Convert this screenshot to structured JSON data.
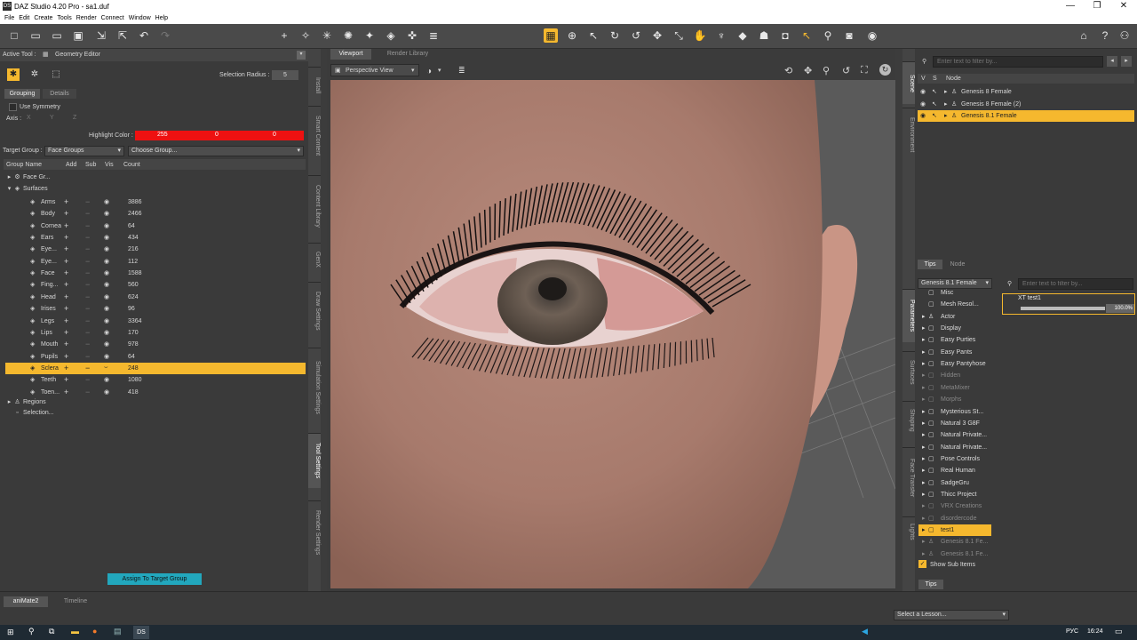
{
  "window": {
    "title": "DAZ Studio 4.20 Pro - sa1.duf",
    "min": "—",
    "max": "❐",
    "close": "✕"
  },
  "menu": [
    "File",
    "Edit",
    "Create",
    "Tools",
    "Render",
    "Connect",
    "Window",
    "Help"
  ],
  "left": {
    "active_tool_label": "Active Tool :",
    "active_tool": "Geometry Editor",
    "selection_radius_label": "Selection Radius :",
    "selection_radius": "5",
    "tabs": [
      "Grouping",
      "Details"
    ],
    "use_symmetry": "Use Symmetry",
    "axis": "Axis :",
    "axis_options": [
      "X",
      "Y",
      "Z"
    ],
    "highlight_label": "Highlight Color :",
    "highlight": [
      "255",
      "0",
      "0"
    ],
    "target_group_label": "Target Group :",
    "target_group": "Face Groups",
    "choose_group": "Choose Group...",
    "headers": [
      "Group Name",
      "Add",
      "Sub",
      "Vis",
      "Count"
    ],
    "face_groups": "Face Gr...",
    "surfaces": "Surfaces",
    "items": [
      {
        "name": "Arms",
        "count": "3886"
      },
      {
        "name": "Body",
        "count": "2466"
      },
      {
        "name": "Cornea",
        "count": "64"
      },
      {
        "name": "Ears",
        "count": "434"
      },
      {
        "name": "Eye...",
        "count": "216"
      },
      {
        "name": "Eye...",
        "count": "112"
      },
      {
        "name": "Face",
        "count": "1588"
      },
      {
        "name": "Fing...",
        "count": "560"
      },
      {
        "name": "Head",
        "count": "624"
      },
      {
        "name": "Irises",
        "count": "96"
      },
      {
        "name": "Legs",
        "count": "3364"
      },
      {
        "name": "Lips",
        "count": "170"
      },
      {
        "name": "Mouth",
        "count": "978"
      },
      {
        "name": "Pupils",
        "count": "64"
      },
      {
        "name": "Sclera",
        "count": "248"
      },
      {
        "name": "Teeth",
        "count": "1080"
      },
      {
        "name": "Toen...",
        "count": "418"
      }
    ],
    "regions": "Regions",
    "selection": "Selection...",
    "assign_button": "Assign To Target Group"
  },
  "side_tabs": [
    "Install",
    "Smart Content",
    "Content Library",
    "GenX",
    "Draw Settings",
    "Simulation Settings",
    "Tool Settings",
    "Render Settings"
  ],
  "viewport": {
    "tabs": [
      "Viewport",
      "Render Library"
    ],
    "view": "Perspective View"
  },
  "right_side_tabs": [
    "Scene",
    "Environment",
    "Parameters",
    "Surfaces",
    "Shaping",
    "Face Transfer",
    "Lights"
  ],
  "scene": {
    "filter_placeholder": "Enter text to filter by...",
    "cols": [
      "V",
      "S",
      "Node"
    ],
    "nodes": [
      "Genesis 8 Female",
      "Genesis 8 Female (2)",
      "Genesis 8.1 Female"
    ]
  },
  "tips_tabs": [
    "Tips",
    "Node"
  ],
  "params": {
    "figure": "Genesis 8.1 Female",
    "filter_placeholder": "Enter text to filter by...",
    "slider_label": "XT test1",
    "slider_value": "100.0%",
    "tree": [
      {
        "t": "Misc",
        "d": false
      },
      {
        "t": "Mesh Resol...",
        "d": false
      },
      {
        "t": "Actor",
        "d": false
      },
      {
        "t": "Display",
        "d": false
      },
      {
        "t": "Easy Purties",
        "d": false
      },
      {
        "t": "Easy Pants",
        "d": false
      },
      {
        "t": "Easy Pantyhose",
        "d": false
      },
      {
        "t": "Hidden",
        "d": true
      },
      {
        "t": "MetaMixer",
        "d": true
      },
      {
        "t": "Morphs",
        "d": true
      },
      {
        "t": "Mysterious St...",
        "d": false
      },
      {
        "t": "Natural 3 G8F",
        "d": false
      },
      {
        "t": "Natural Private...",
        "d": false
      },
      {
        "t": "Natural Private...",
        "d": false
      },
      {
        "t": "Pose Controls",
        "d": false
      },
      {
        "t": "Real Human",
        "d": false
      },
      {
        "t": "SadgeGru",
        "d": false
      },
      {
        "t": "Thicc Project",
        "d": false
      },
      {
        "t": "VRX Creations",
        "d": true
      },
      {
        "t": "disordercode",
        "d": true
      },
      {
        "t": "test1",
        "d": false
      },
      {
        "t": "Genesis 8.1 Fe...",
        "d": true
      },
      {
        "t": "Genesis 8.1 Fe...",
        "d": true
      }
    ],
    "show_sub": "Show Sub Items"
  },
  "tips_bottom": "Tips",
  "bottom": {
    "tabs": [
      "aniMate2",
      "Timeline"
    ],
    "lesson": "Select a Lesson..."
  },
  "taskbar": {
    "lang": "РУС",
    "time": "16:24"
  }
}
